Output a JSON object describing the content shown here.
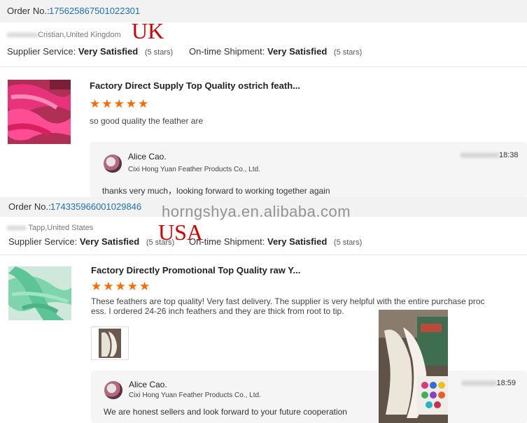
{
  "review1": {
    "order_label": "Order No.:",
    "order_number": "175625867501022301",
    "buyer_blurred": "xxxxxxxx",
    "buyer": "Cristian,United Kingdom",
    "country_tag": "UK",
    "supplier_service_label": "Supplier Service:",
    "supplier_service_value": "Very Satisfied",
    "supplier_service_stars": "(5 stars)",
    "shipment_label": "On-time Shipment:",
    "shipment_value": "Very Satisfied",
    "shipment_stars": "(5 stars)",
    "product_title": "Factory Direct Supply Top Quality ostrich feath...",
    "stars": "★★★★★",
    "rating": 5,
    "review_text": "so good quality the feather are",
    "reply": {
      "name": "Alice Cao.",
      "company": "Cixi Hong Yuan Feather Products Co., Ltd.",
      "text": "thanks very much，looking forward to working together again",
      "time_blurred": "xxxxxxxxxx",
      "time": "18:38"
    }
  },
  "watermark": "horngshya.en.alibaba.com",
  "review2": {
    "order_label": "Order No.:",
    "order_number": "174335966001029846",
    "buyer_blurred": "xxxxx",
    "buyer": "Tapp,United States",
    "country_tag": "USA",
    "supplier_service_label": "Supplier Service:",
    "supplier_service_value": "Very Satisfied",
    "supplier_service_stars": "(5 stars)",
    "shipment_label": "On-time Shipment:",
    "shipment_value": "Very Satisfied",
    "shipment_stars": "(5 stars)",
    "product_title": "Factory Directly Promotional Top Quality raw Y...",
    "stars": "★★★★★",
    "rating": 5,
    "review_text_line1": "These feathers are top quality! Very fast delivery.  The supplier is very helpful with the entire purchase proc",
    "review_text_line2": "ess. I ordered 24-26 inch feathers and they are thick from root to tip.",
    "reply": {
      "name": "Alice Cao.",
      "company": "Cixi Hong Yuan Feather Products Co., Ltd.",
      "text": "We are honest sellers and look forward to your future cooperation",
      "time_blurred": "xxxxxxxxx",
      "time": "18:59"
    }
  }
}
